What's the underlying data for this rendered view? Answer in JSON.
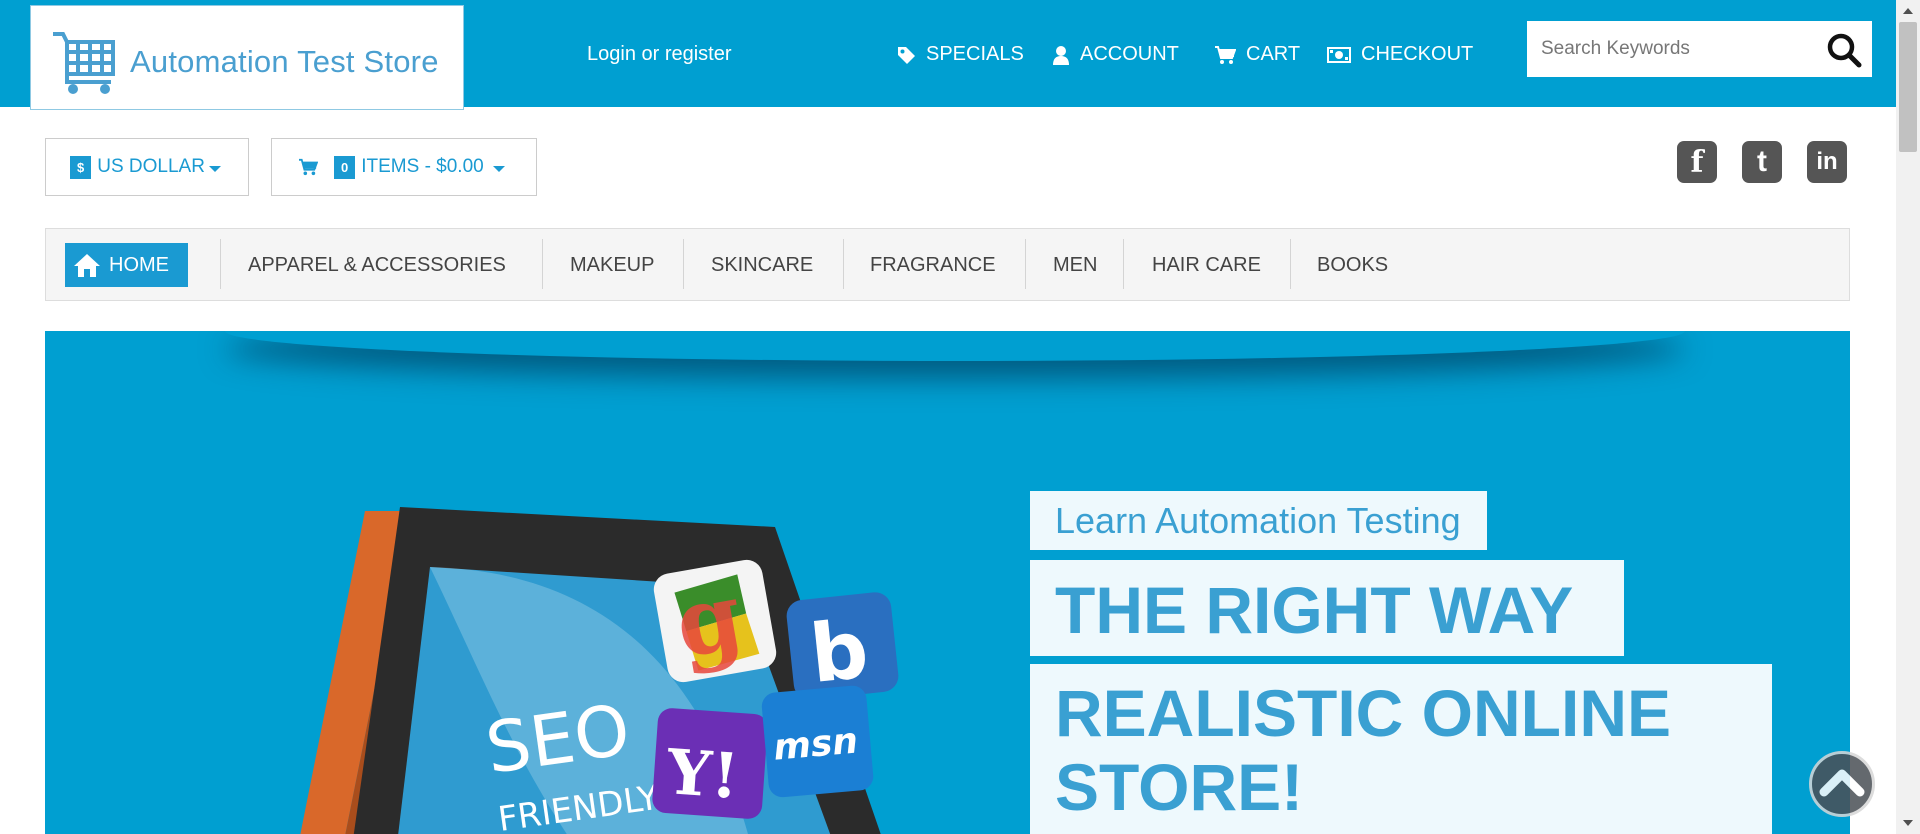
{
  "header": {
    "logo_text": "Automation Test Store",
    "login_link": "Login or register",
    "nav": [
      {
        "label": "SPECIALS",
        "icon": "tag-icon"
      },
      {
        "label": "ACCOUNT",
        "icon": "user-icon"
      },
      {
        "label": "CART",
        "icon": "cart-icon"
      },
      {
        "label": "CHECKOUT",
        "icon": "money-icon"
      }
    ],
    "search": {
      "placeholder": "Search Keywords",
      "value": ""
    }
  },
  "toolbar": {
    "currency_symbol": "$",
    "currency_label": "US DOLLAR",
    "cart_count": "0",
    "cart_label": "ITEMS - $0.00"
  },
  "social": [
    {
      "name": "facebook",
      "glyph": "f"
    },
    {
      "name": "twitter",
      "glyph": "t"
    },
    {
      "name": "linkedin",
      "glyph": "in"
    }
  ],
  "menu": {
    "home_label": "HOME",
    "items": [
      "APPAREL & ACCESSORIES",
      "MAKEUP",
      "SKINCARE",
      "FRAGRANCE",
      "MEN",
      "HAIR CARE",
      "BOOKS"
    ]
  },
  "hero": {
    "line1": "Learn Automation Testing",
    "line2": "THE RIGHT WAY",
    "line3a": "REALISTIC ONLINE",
    "line3b": "STORE!",
    "laptop_text1": "SEO",
    "laptop_text2": "FRIENDLY",
    "badge_yahoo": "Y!",
    "badge_msn": "msn"
  },
  "colors": {
    "brand": "#009fd1",
    "accent": "#1a9ad2",
    "hero_text": "#3aa0d2"
  }
}
